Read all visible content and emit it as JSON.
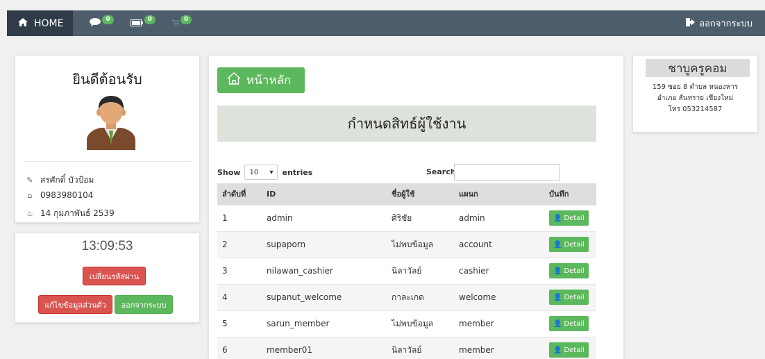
{
  "navbar": {
    "home_label": "HOME",
    "messages_count": "0",
    "battery_count": "0",
    "cart_count": "0",
    "logout_label": "ออกจากระบบ"
  },
  "profile": {
    "welcome": "ยินดีต้อนรับ",
    "name": "สรศักดิ์ บัวป้อม",
    "phone": "0983980104",
    "birthdate": "14 กุมภาพันธ์ 2539"
  },
  "clock": {
    "time": "13:09:53",
    "change_password_label": "เปลี่ยนรหัสผ่าน",
    "edit_profile_label": "แก้ไขข้อมูลส่วนตัว",
    "logout_label": "ออกจากระบบ"
  },
  "main": {
    "home_button_label": "หน้าหลัก",
    "title": "กำหนดสิทธ์ผู้ใช้งาน",
    "show_label": "Show",
    "entries_value": "10",
    "entries_label": "entries",
    "search_label": "Search:",
    "columns": [
      "ลำดับที่",
      "ID",
      "ชื่อผู้ใช้",
      "แผนก",
      "บันทึก"
    ],
    "detail_label": "Detail",
    "rows": [
      {
        "no": "1",
        "id": "admin",
        "name": "ศิริชัย",
        "dept": "admin"
      },
      {
        "no": "2",
        "id": "supaporn",
        "name": "ไม่พบข้อมูล",
        "dept": "account"
      },
      {
        "no": "3",
        "id": "nilawan_cashier",
        "name": "นิลาวัลย์",
        "dept": "cashier"
      },
      {
        "no": "4",
        "id": "supanut_welcome",
        "name": "กาละเกด",
        "dept": "welcome"
      },
      {
        "no": "5",
        "id": "sarun_member",
        "name": "ไม่พบข้อมูล",
        "dept": "member"
      },
      {
        "no": "6",
        "id": "member01",
        "name": "นิลาวัลย์",
        "dept": "member"
      }
    ]
  },
  "store": {
    "name": "ชาบูครูคอม",
    "address_line1": "159 ซอย 8 ตำบล หนองหาร",
    "address_line2": "อำเภอ สันทราย เชียงใหม่",
    "phone_line": "โทร 053214587"
  }
}
